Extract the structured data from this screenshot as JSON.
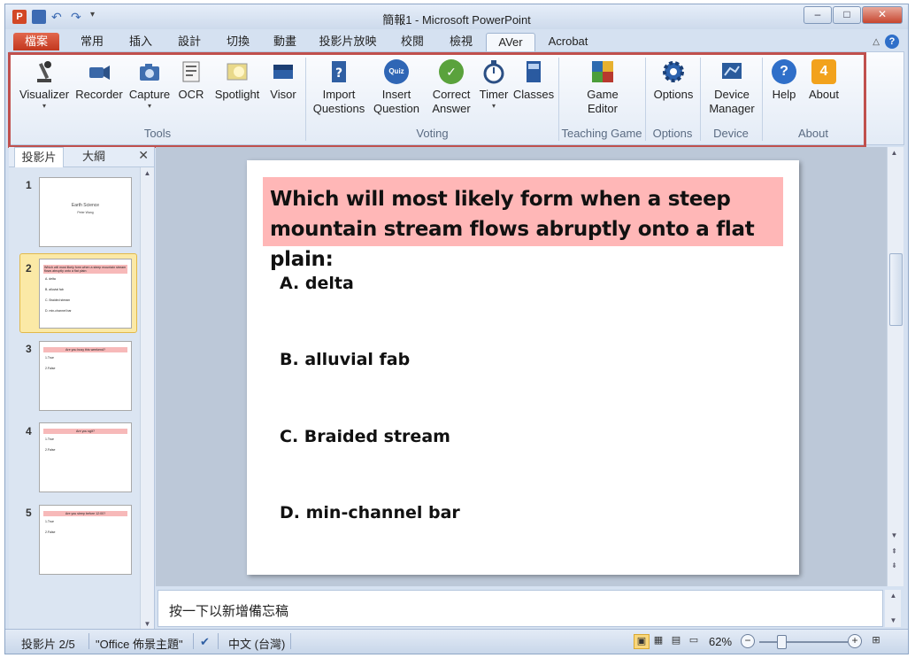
{
  "window": {
    "title": "簡報1 - Microsoft PowerPoint",
    "controls": {
      "minimize": "–",
      "maximize": "□",
      "close": "✕"
    }
  },
  "qat": {
    "logo": "P",
    "undo": "↶",
    "redo": "↷",
    "dropdown": "▾"
  },
  "tabs": [
    {
      "label": "檔案"
    },
    {
      "label": "常用"
    },
    {
      "label": "插入"
    },
    {
      "label": "設計"
    },
    {
      "label": "切換"
    },
    {
      "label": "動畫"
    },
    {
      "label": "投影片放映"
    },
    {
      "label": "校閱"
    },
    {
      "label": "檢視"
    },
    {
      "label": "AVer"
    },
    {
      "label": "Acrobat"
    }
  ],
  "ribbon": {
    "groups": [
      {
        "name": "Tools"
      },
      {
        "name": "Voting"
      },
      {
        "name": "Teaching Game"
      },
      {
        "name": "Options"
      },
      {
        "name": "Device"
      },
      {
        "name": "About"
      }
    ],
    "buttons": {
      "visualizer": {
        "label": "Visualizer",
        "icon": "visualizer-icon"
      },
      "recorder": {
        "label": "Recorder",
        "icon": "recorder-icon"
      },
      "capture": {
        "label": "Capture",
        "icon": "camera-icon"
      },
      "ocr": {
        "label": "OCR",
        "icon": "ocr-icon"
      },
      "spotlight": {
        "label": "Spotlight",
        "icon": "spotlight-icon"
      },
      "visor": {
        "label": "Visor",
        "icon": "visor-icon"
      },
      "import_questions": {
        "line1": "Import",
        "line2": "Questions",
        "icon": "import-icon"
      },
      "insert_question": {
        "line1": "Insert",
        "line2": "Question",
        "icon": "quiz-icon",
        "badge": "Quiz"
      },
      "correct_answer": {
        "line1": "Correct",
        "line2": "Answer",
        "icon": "checkmark-icon"
      },
      "timer": {
        "label": "Timer",
        "icon": "stopwatch-icon"
      },
      "classes": {
        "label": "Classes",
        "icon": "classes-icon"
      },
      "game_editor": {
        "line1": "Game",
        "line2": "Editor",
        "icon": "game-editor-icon"
      },
      "options": {
        "label": "Options",
        "icon": "gear-icon"
      },
      "device_manager": {
        "line1": "Device",
        "line2": "Manager",
        "icon": "device-icon"
      },
      "help": {
        "label": "Help",
        "icon": "help-icon"
      },
      "about": {
        "label": "About",
        "icon": "about-icon"
      }
    },
    "dropdown_arrow": "▾"
  },
  "left_pane": {
    "tab_slides": "投影片",
    "tab_outline": "大綱",
    "close": "✕",
    "slides": [
      {
        "num": "1",
        "title": "Earth Science",
        "subtitle": "Peter Wang"
      },
      {
        "num": "2",
        "title": "Which will most likely form when a steep mountain stream flows abruptly onto a flat plain:",
        "options": [
          "A. delta",
          "B. alluvial fab",
          "C. Braided stream",
          "D. min-channel bar"
        ]
      },
      {
        "num": "3",
        "title": "Are you busy this weekend?",
        "options": [
          "1.True",
          "2.False"
        ]
      },
      {
        "num": "4",
        "title": "Are you sgit?",
        "options": [
          "1.True",
          "2.False"
        ]
      },
      {
        "num": "5",
        "title": "Are you sleep before 12:00?",
        "options": [
          "1.True",
          "2.False"
        ]
      }
    ]
  },
  "slide": {
    "question": "Which will most likely form when a steep mountain stream flows abruptly onto a flat plain:",
    "options": [
      "A. delta",
      "B. alluvial fab",
      "C. Braided stream",
      "D. min-channel bar"
    ]
  },
  "notes": {
    "placeholder": "按一下以新增備忘稿"
  },
  "status": {
    "slide_indicator": "投影片 2/5",
    "theme": "\"Office 佈景主題\"",
    "language": "中文 (台灣)",
    "zoom": "62%"
  },
  "colors": {
    "question_band": "#ffb7b7",
    "file_tab": "#c2371e",
    "highlight_frame": "#c0504d",
    "selected_thumb": "#fbe9a6"
  }
}
